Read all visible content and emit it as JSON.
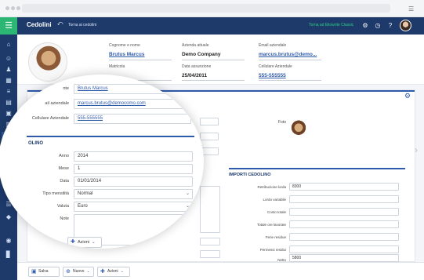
{
  "app": {
    "title": "Cedolini",
    "back_label": "Torna ai cedolini",
    "company_link": "Torna ad Eliowrite Classic"
  },
  "employee": {
    "cognome_nome_label": "Cognome e nome",
    "cognome_nome": "Brutus Marcus",
    "matricola_label": "Matricola",
    "azienda_label": "Azienda attuale",
    "azienda": "Demo Company",
    "data_assunzione_label": "Data assunzione",
    "data_assunzione": "25/04/2011",
    "email_label": "Email aziendale",
    "email": "marcus.brutus@demo...",
    "cellulare_label": "Cellulare Aziendale",
    "cellulare": "555-555555"
  },
  "form": {
    "foto_label": "Foto",
    "importi_title": "IMPORTI CEDOLINO",
    "importi": [
      {
        "label": "Retribuzione lorda",
        "value": "8300"
      },
      {
        "label": "Lordo variabile",
        "value": ""
      },
      {
        "label": "Costo totale",
        "value": ""
      },
      {
        "label": "Totale ore lavorate",
        "value": ""
      },
      {
        "label": "Ferie residue",
        "value": ""
      },
      {
        "label": "Permessi residui",
        "value": ""
      },
      {
        "label": "Netto",
        "value": "5800"
      }
    ]
  },
  "magnified": {
    "nome_label": "nte",
    "nome_value": "Brutus Marcus",
    "email_label": "ail aziendale",
    "email_value": "marcus.brutus@democomo.com",
    "cell_label": "Cellulare Aziendale",
    "cell_value": "555-555555",
    "cedolino_title": "OLINO",
    "fields": [
      {
        "label": "Anno",
        "value": "2014"
      },
      {
        "label": "Mese",
        "value": "1"
      },
      {
        "label": "Data",
        "value": "01/01/2014"
      },
      {
        "label": "Tipo mensilità",
        "value": "Normal"
      },
      {
        "label": "Valuta",
        "value": "Euro"
      },
      {
        "label": "Note",
        "value": ""
      }
    ],
    "azioni_label": "Azioni"
  },
  "toolbar": {
    "save_label": "Salva",
    "new_label": "Nuovo",
    "actions_label": "Azioni"
  },
  "colors": {
    "header_bg": "#1d3a6b",
    "accent_green": "#2bb673",
    "accent_blue": "#2e5aac"
  }
}
